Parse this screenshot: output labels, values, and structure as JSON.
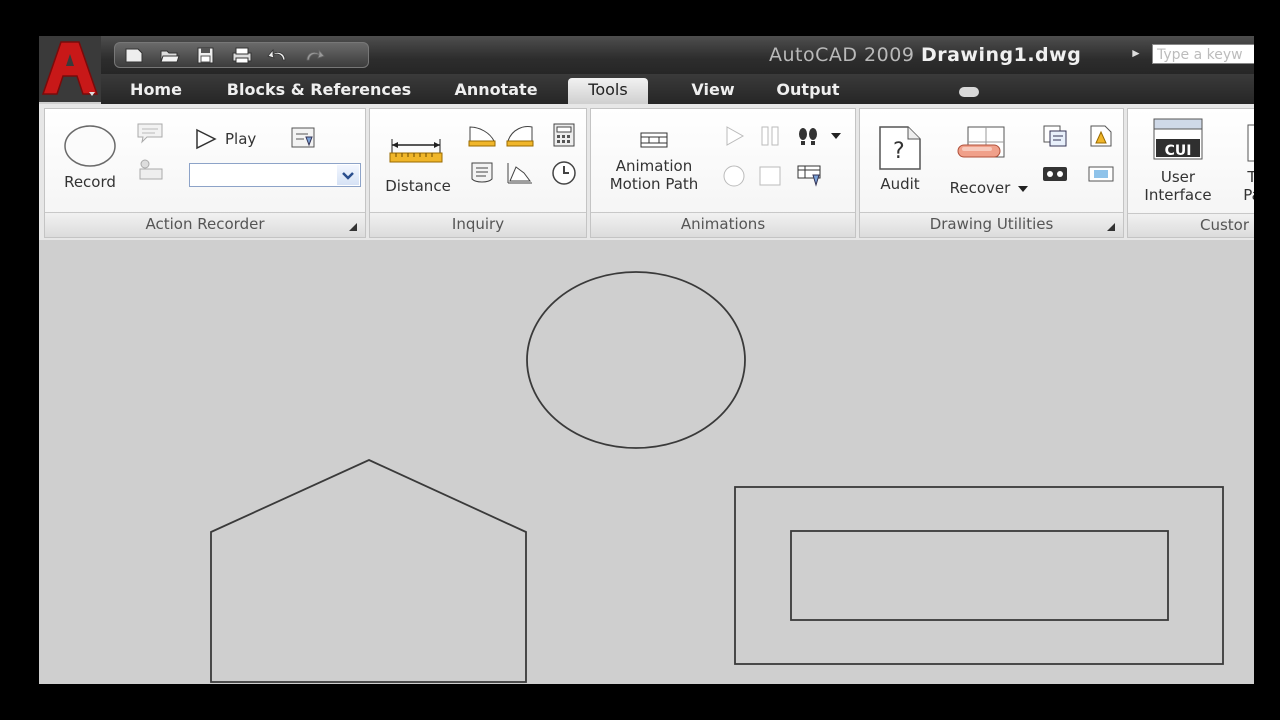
{
  "window": {
    "title_app": "AutoCAD 2009",
    "title_doc": "Drawing1.dwg",
    "search_placeholder": "Type a keyw",
    "accent": "#cc1f1f"
  },
  "quick_access": {
    "icons": [
      "new-icon",
      "open-icon",
      "save-icon",
      "plot-icon",
      "undo-icon",
      "redo-icon"
    ]
  },
  "tabs": [
    {
      "label": "Home"
    },
    {
      "label": "Blocks & References"
    },
    {
      "label": "Annotate"
    },
    {
      "label": "Tools",
      "active": true
    },
    {
      "label": "View"
    },
    {
      "label": "Output"
    }
  ],
  "panels": {
    "action_recorder": {
      "title": "Action Recorder",
      "record_label": "Record",
      "play_label": "Play"
    },
    "inquiry": {
      "title": "Inquiry",
      "distance_label": "Distance"
    },
    "animations": {
      "title": "Animations",
      "motion_path_line1": "Animation",
      "motion_path_line2": "Motion Path"
    },
    "drawing_utilities": {
      "title": "Drawing Utilities",
      "audit_label": "Audit",
      "recover_label": "Recover"
    },
    "customization": {
      "title": "Custor",
      "user_interface_line1": "User",
      "user_interface_line2": "Interface",
      "cui_badge": "CUI",
      "partial_label": "Pa",
      "partial_label_top": "T"
    }
  },
  "drawing": {
    "background": "#cfcfcf",
    "stroke": "#3a3a3a",
    "shapes": [
      "ellipse",
      "pentagon",
      "outer-rectangle",
      "inner-rectangle"
    ]
  }
}
